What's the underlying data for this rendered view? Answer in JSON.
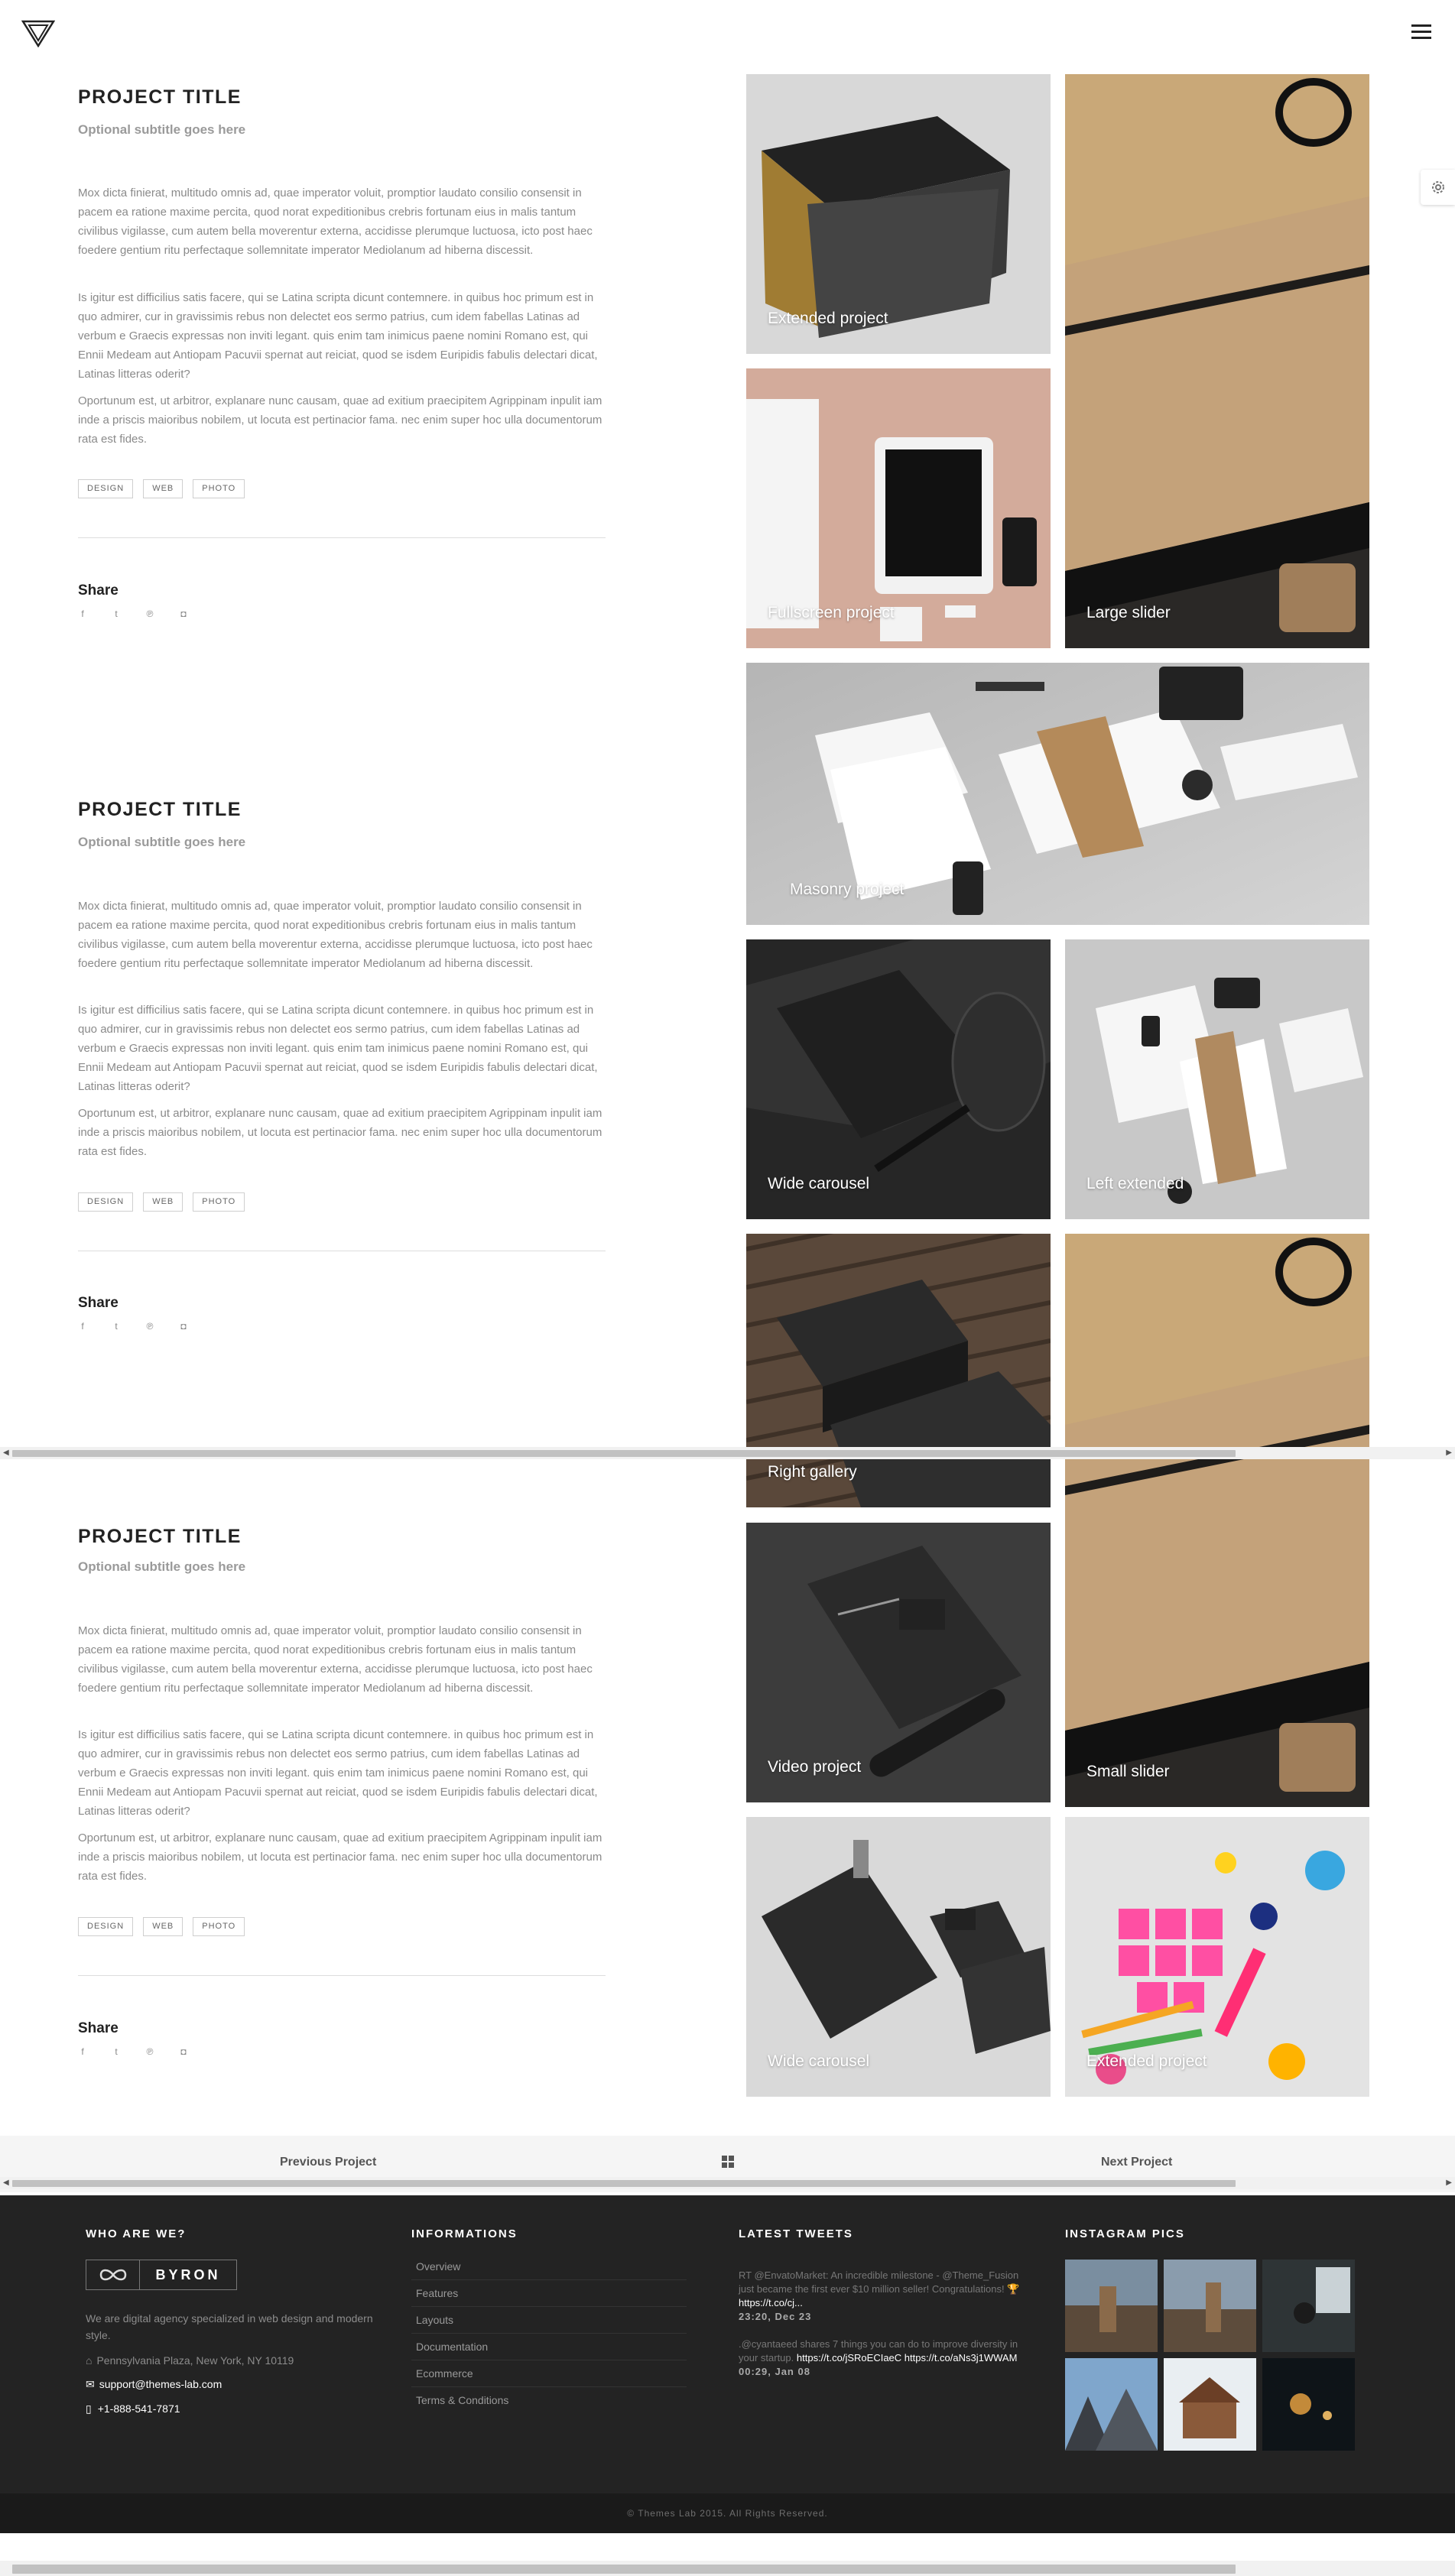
{
  "header": {
    "logo": "logo-triangle",
    "menu_icon": "hamburger-icon",
    "settings_icon": "gear-icon"
  },
  "projects": [
    {
      "title": "PROJECT TITLE",
      "subtitle": "Optional subtitle goes here",
      "paragraphs": [
        "Mox dicta finierat, multitudo omnis ad, quae imperator voluit, promptior laudato consilio consensit in pacem ea ratione maxime percita, quod norat expeditionibus crebris fortunam eius in malis tantum civilibus vigilasse, cum autem bella moverentur externa, accidisse plerumque luctuosa, icto post haec foedere gentium ritu perfectaque sollemnitate imperator Mediolanum ad hiberna discessit.",
        "Is igitur est difficilius satis facere, qui se Latina scripta dicunt contemnere. in quibus hoc primum est in quo admirer, cur in gravissimis rebus non delectet eos sermo patrius, cum idem fabellas Latinas ad verbum e Graecis expressas non inviti legant. quis enim tam inimicus paene nomini Romano est, qui Ennii Medeam aut Antiopam Pacuvii spernat aut reiciat, quod se isdem Euripidis fabulis delectari dicat, Latinas litteras oderit?",
        "Oportunum est, ut arbitror, explanare nunc causam, quae ad exitium praecipitem Agrippinam inpulit iam inde a priscis maioribus nobilem, ut locuta est pertinacior fama. nec enim super hoc ulla documentorum rata est fides."
      ],
      "tags": [
        "DESIGN",
        "WEB",
        "PHOTO"
      ],
      "share_label": "Share"
    },
    {
      "title": "PROJECT TITLE",
      "subtitle": "Optional subtitle goes here",
      "paragraphs": [
        "Mox dicta finierat, multitudo omnis ad, quae imperator voluit, promptior laudato consilio consensit in pacem ea ratione maxime percita, quod norat expeditionibus crebris fortunam eius in malis tantum civilibus vigilasse, cum autem bella moverentur externa, accidisse plerumque luctuosa, icto post haec foedere gentium ritu perfectaque sollemnitate imperator Mediolanum ad hiberna discessit.",
        "Is igitur est difficilius satis facere, qui se Latina scripta dicunt contemnere. in quibus hoc primum est in quo admirer, cur in gravissimis rebus non delectet eos sermo patrius, cum idem fabellas Latinas ad verbum e Graecis expressas non inviti legant. quis enim tam inimicus paene nomini Romano est, qui Ennii Medeam aut Antiopam Pacuvii spernat aut reiciat, quod se isdem Euripidis fabulis delectari dicat, Latinas litteras oderit?",
        "Oportunum est, ut arbitror, explanare nunc causam, quae ad exitium praecipitem Agrippinam inpulit iam inde a priscis maioribus nobilem, ut locuta est pertinacior fama. nec enim super hoc ulla documentorum rata est fides."
      ],
      "tags": [
        "DESIGN",
        "WEB",
        "PHOTO"
      ],
      "share_label": "Share"
    },
    {
      "title": "PROJECT TITLE",
      "subtitle": "Optional subtitle goes here",
      "paragraphs": [
        "Mox dicta finierat, multitudo omnis ad, quae imperator voluit, promptior laudato consilio consensit in pacem ea ratione maxime percita, quod norat expeditionibus crebris fortunam eius in malis tantum civilibus vigilasse, cum autem bella moverentur externa, accidisse plerumque luctuosa, icto post haec foedere gentium ritu perfectaque sollemnitate imperator Mediolanum ad hiberna discessit.",
        "Is igitur est difficilius satis facere, qui se Latina scripta dicunt contemnere. in quibus hoc primum est in quo admirer, cur in gravissimis rebus non delectet eos sermo patrius, cum idem fabellas Latinas ad verbum e Graecis expressas non inviti legant. quis enim tam inimicus paene nomini Romano est, qui Ennii Medeam aut Antiopam Pacuvii spernat aut reiciat, quod se isdem Euripidis fabulis delectari dicat, Latinas litteras oderit?",
        "Oportunum est, ut arbitror, explanare nunc causam, quae ad exitium praecipitem Agrippinam inpulit iam inde a priscis maioribus nobilem, ut locuta est pertinacior fama. nec enim super hoc ulla documentorum rata est fides."
      ],
      "tags": [
        "DESIGN",
        "WEB",
        "PHOTO"
      ],
      "share_label": "Share"
    }
  ],
  "share_icons": [
    "facebook-icon",
    "twitter-icon",
    "pinterest-icon",
    "instagram-icon"
  ],
  "tiles": [
    {
      "label": "Extended project"
    },
    {
      "label": "Large slider"
    },
    {
      "label": "Fullscreen project"
    },
    {
      "label": "Masonry project"
    },
    {
      "label": "Wide carousel"
    },
    {
      "label": "Left extended"
    },
    {
      "label": "Right gallery"
    },
    {
      "label": "Video project"
    },
    {
      "label": "Small slider"
    },
    {
      "label": "Wide carousel"
    },
    {
      "label": "Extended project"
    }
  ],
  "pager": {
    "prev": "Previous Project",
    "next": "Next Project",
    "grid_icon": "grid-icon"
  },
  "footer": {
    "about": {
      "heading": "WHO ARE WE?",
      "brand": "BYRON",
      "description": "We are digital agency specialized in web design and modern style.",
      "address": "Pennsylvania Plaza, New York, NY 10119",
      "email": "support@themes-lab.com",
      "phone": "+1-888-541-7871"
    },
    "informations": {
      "heading": "INFORMATIONS",
      "links": [
        "Overview",
        "Features",
        "Layouts",
        "Documentation",
        "Ecommerce",
        "Terms & Conditions"
      ]
    },
    "tweets": {
      "heading": "LATEST TWEETS",
      "items": [
        {
          "text": "RT @EnvatoMarket: An incredible milestone - @Theme_Fusion just became the first ever $10 million seller! Congratulations! 🏆",
          "link": "https://t.co/cj...",
          "date": "23:20, Dec 23"
        },
        {
          "text": ".@cyantaeed shares 7 things you can do to improve diversity in your startup.",
          "link": "https://t.co/jSRoECIaeC",
          "link2": "https://t.co/aNs3j1WWAM",
          "date": "00:29, Jan 08"
        }
      ]
    },
    "instagram": {
      "heading": "INSTAGRAM PICS"
    },
    "copyright": "© Themes Lab 2015. All Rights Reserved."
  }
}
